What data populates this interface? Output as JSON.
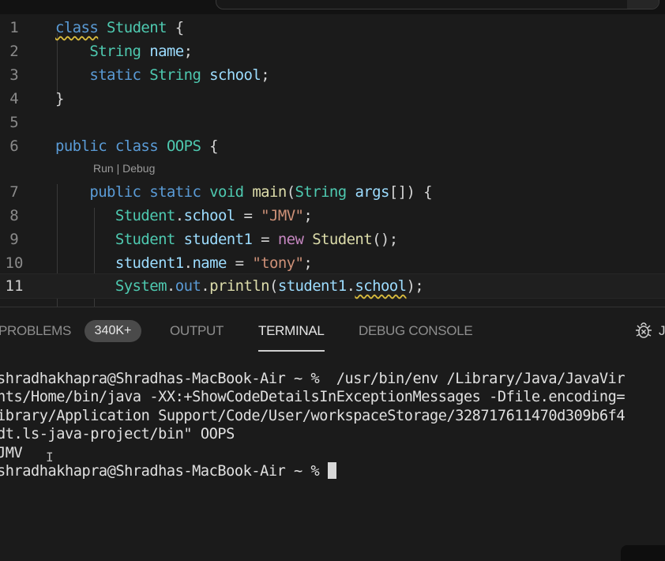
{
  "editor": {
    "lines": [
      {
        "n": "1",
        "tokens": [
          {
            "t": "class",
            "c": "kw sq"
          },
          {
            "t": " "
          },
          {
            "t": "Student",
            "c": "ty"
          },
          {
            "t": " {",
            "c": "pu"
          }
        ]
      },
      {
        "n": "2",
        "tokens": [
          {
            "t": "    "
          },
          {
            "t": "String",
            "c": "ty"
          },
          {
            "t": " "
          },
          {
            "t": "name",
            "c": "va"
          },
          {
            "t": ";",
            "c": "pu"
          }
        ]
      },
      {
        "n": "3",
        "tokens": [
          {
            "t": "    "
          },
          {
            "t": "static",
            "c": "kw"
          },
          {
            "t": " "
          },
          {
            "t": "String",
            "c": "ty"
          },
          {
            "t": " "
          },
          {
            "t": "school",
            "c": "va"
          },
          {
            "t": ";",
            "c": "pu"
          }
        ]
      },
      {
        "n": "4",
        "tokens": [
          {
            "t": "}",
            "c": "pu"
          }
        ]
      },
      {
        "n": "5",
        "tokens": []
      },
      {
        "n": "6",
        "tokens": [
          {
            "t": "public",
            "c": "kw"
          },
          {
            "t": " "
          },
          {
            "t": "class",
            "c": "kw"
          },
          {
            "t": " "
          },
          {
            "t": "OOPS",
            "c": "ty"
          },
          {
            "t": " {",
            "c": "pu"
          }
        ]
      },
      {
        "n": "7",
        "tokens": [
          {
            "t": "    "
          },
          {
            "t": "public",
            "c": "kw"
          },
          {
            "t": " "
          },
          {
            "t": "static",
            "c": "kw"
          },
          {
            "t": " "
          },
          {
            "t": "void",
            "c": "ty"
          },
          {
            "t": " "
          },
          {
            "t": "main",
            "c": "fn"
          },
          {
            "t": "(",
            "c": "pu"
          },
          {
            "t": "String",
            "c": "ty"
          },
          {
            "t": " "
          },
          {
            "t": "args",
            "c": "va"
          },
          {
            "t": "[]) {",
            "c": "pu"
          }
        ]
      },
      {
        "n": "8",
        "tokens": [
          {
            "t": "       "
          },
          {
            "t": "Student",
            "c": "ty"
          },
          {
            "t": ".",
            "c": "pu"
          },
          {
            "t": "school",
            "c": "va"
          },
          {
            "t": " = ",
            "c": "pu"
          },
          {
            "t": "\"JMV\"",
            "c": "st"
          },
          {
            "t": ";",
            "c": "pu"
          }
        ]
      },
      {
        "n": "9",
        "tokens": [
          {
            "t": "       "
          },
          {
            "t": "Student",
            "c": "ty"
          },
          {
            "t": " "
          },
          {
            "t": "student1",
            "c": "va"
          },
          {
            "t": " = ",
            "c": "pu"
          },
          {
            "t": "new",
            "c": "nw"
          },
          {
            "t": " "
          },
          {
            "t": "Student",
            "c": "fn"
          },
          {
            "t": "();",
            "c": "pu"
          }
        ]
      },
      {
        "n": "10",
        "tokens": [
          {
            "t": "       "
          },
          {
            "t": "student1",
            "c": "va"
          },
          {
            "t": ".",
            "c": "pu"
          },
          {
            "t": "name",
            "c": "va"
          },
          {
            "t": " = ",
            "c": "pu"
          },
          {
            "t": "\"tony\"",
            "c": "st"
          },
          {
            "t": ";",
            "c": "pu"
          }
        ]
      },
      {
        "n": "11",
        "tokens": [
          {
            "t": "       "
          },
          {
            "t": "System",
            "c": "ty"
          },
          {
            "t": ".",
            "c": "pu"
          },
          {
            "t": "out",
            "c": "kw"
          },
          {
            "t": ".",
            "c": "pu"
          },
          {
            "t": "println",
            "c": "fn"
          },
          {
            "t": "(",
            "c": "pu"
          },
          {
            "t": "student1",
            "c": "va"
          },
          {
            "t": ".",
            "c": "pu"
          },
          {
            "t": "school",
            "c": "va sq"
          },
          {
            "t": ");",
            "c": "pu"
          }
        ]
      }
    ],
    "codelens": "Run | Debug"
  },
  "panel": {
    "tabs": {
      "problems": "PROBLEMS",
      "output": "OUTPUT",
      "terminal": "TERMINAL",
      "debug_console": "DEBUG CONSOLE",
      "partial": "J"
    },
    "problems_badge": "340K+",
    "terminal_lines": [
      "shradhakhapra@Shradhas-MacBook-Air ~ %  /usr/bin/env /Library/Java/JavaVir",
      "nts/Home/bin/java -XX:+ShowCodeDetailsInExceptionMessages -Dfile.encoding=",
      "ibrary/Application Support/Code/User/workspaceStorage/328717611470d309b6f4",
      "dt.ls-java-project/bin\" OOPS",
      "JMV"
    ],
    "prompt": "shradhakhapra@Shradhas-MacBook-Air ~ % "
  }
}
